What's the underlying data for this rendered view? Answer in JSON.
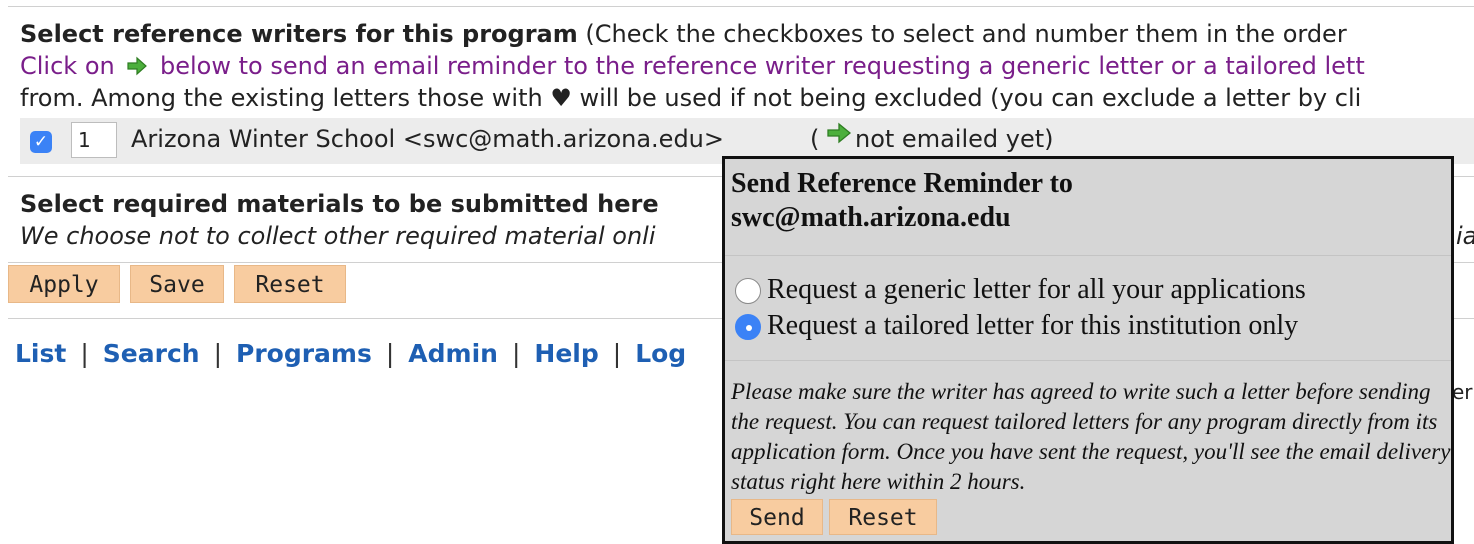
{
  "references": {
    "heading": "Select reference writers for this program",
    "instruction": "(Check the checkboxes to select and number them in the order",
    "reminder_click": "Click on",
    "reminder_text": "below to send an email reminder to the reference writer requesting a generic letter or a tailored lett",
    "existing_text": "from. Among the existing letters those with ♥ will be used if not being excluded (you can exclude a letter by cli",
    "writer": {
      "checked": true,
      "order": "1",
      "name": "Arizona Winter School <swc@math.arizona.edu>",
      "paren_open": "(",
      "status": "not emailed yet)"
    }
  },
  "materials": {
    "heading": "Select required materials to be submitted here",
    "note": "We choose not to collect other required material onli",
    "right_fragment_1": "ial",
    "right_fragment_2": "eri"
  },
  "form_buttons": {
    "apply": "Apply",
    "save": "Save",
    "reset": "Reset"
  },
  "nav": {
    "list": "List",
    "search": "Search",
    "programs": "Programs",
    "admin": "Admin",
    "help": "Help",
    "logout": "Log",
    "separator": "|"
  },
  "popup": {
    "title_line1": "Send Reference Reminder to",
    "title_line2": "swc@math.arizona.edu",
    "options": [
      {
        "label": "Request a generic letter for all your applications",
        "selected": false
      },
      {
        "label": "Request a tailored letter for this institution only",
        "selected": true
      }
    ],
    "note": "Please make sure the writer has agreed to write such a letter before sending the request. You can request tailored letters for any program directly from its application form. Once you have sent the request, you'll see the email delivery status right here within 2 hours.",
    "send_label": "Send",
    "reset_label": "Reset"
  },
  "icons": {
    "send_reminder": "green-arrow-icon",
    "heart": "heart-icon",
    "checkbox": "checkbox-checked-icon"
  },
  "colors": {
    "link": "#1e5fb3",
    "purple_text": "#7a1e8a",
    "button_bg": "#f8cca0",
    "checkbox": "#3b82f6"
  }
}
